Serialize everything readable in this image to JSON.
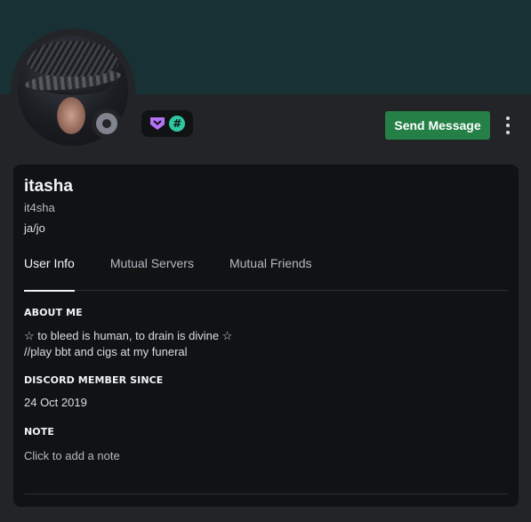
{
  "profile": {
    "display_name": "itasha",
    "username": "it4sha",
    "pronouns": "ja/jo",
    "status": "offline"
  },
  "badges": [
    {
      "name": "nitro-badge-icon",
      "color": "#b473f5"
    },
    {
      "name": "hash-badge-icon",
      "glyph": "#",
      "color": "#2dc7a0"
    }
  ],
  "actions": {
    "send_message": "Send Message"
  },
  "tabs": [
    {
      "label": "User Info",
      "active": true
    },
    {
      "label": "Mutual Servers",
      "active": false
    },
    {
      "label": "Mutual Friends",
      "active": false
    }
  ],
  "about": {
    "heading": "ABOUT ME",
    "line1": "☆ to bleed is human, to drain is divine ☆",
    "line2": "//play bbt and cigs at my funeral"
  },
  "member_since": {
    "heading": "DISCORD MEMBER SINCE",
    "date": "24 Oct 2019"
  },
  "note": {
    "heading": "NOTE",
    "placeholder": "Click to add a note"
  },
  "colors": {
    "banner": "#183134",
    "send_button": "#248046",
    "card": "#111214",
    "background": "#232428"
  }
}
